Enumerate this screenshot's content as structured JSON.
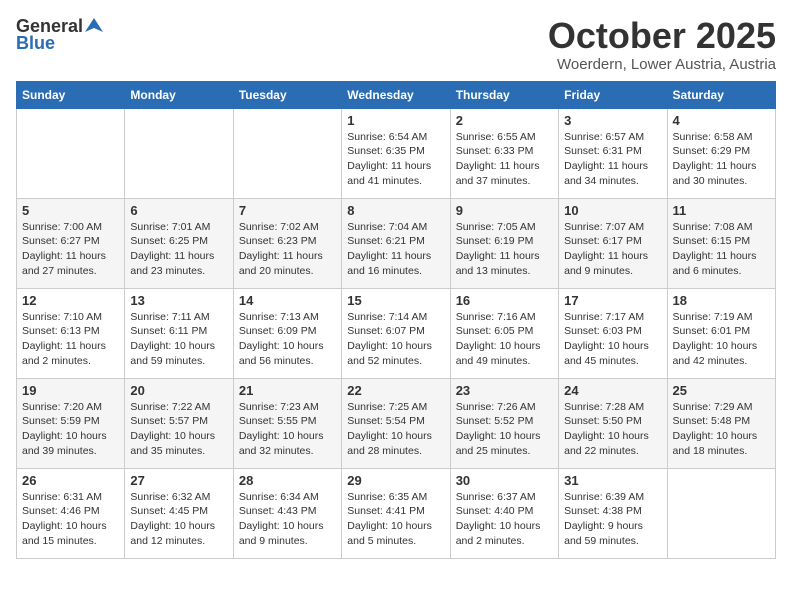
{
  "header": {
    "logo_general": "General",
    "logo_blue": "Blue",
    "month_title": "October 2025",
    "location": "Woerdern, Lower Austria, Austria"
  },
  "weekdays": [
    "Sunday",
    "Monday",
    "Tuesday",
    "Wednesday",
    "Thursday",
    "Friday",
    "Saturday"
  ],
  "weeks": [
    [
      {
        "day": "",
        "info": ""
      },
      {
        "day": "",
        "info": ""
      },
      {
        "day": "",
        "info": ""
      },
      {
        "day": "1",
        "info": "Sunrise: 6:54 AM\nSunset: 6:35 PM\nDaylight: 11 hours\nand 41 minutes."
      },
      {
        "day": "2",
        "info": "Sunrise: 6:55 AM\nSunset: 6:33 PM\nDaylight: 11 hours\nand 37 minutes."
      },
      {
        "day": "3",
        "info": "Sunrise: 6:57 AM\nSunset: 6:31 PM\nDaylight: 11 hours\nand 34 minutes."
      },
      {
        "day": "4",
        "info": "Sunrise: 6:58 AM\nSunset: 6:29 PM\nDaylight: 11 hours\nand 30 minutes."
      }
    ],
    [
      {
        "day": "5",
        "info": "Sunrise: 7:00 AM\nSunset: 6:27 PM\nDaylight: 11 hours\nand 27 minutes."
      },
      {
        "day": "6",
        "info": "Sunrise: 7:01 AM\nSunset: 6:25 PM\nDaylight: 11 hours\nand 23 minutes."
      },
      {
        "day": "7",
        "info": "Sunrise: 7:02 AM\nSunset: 6:23 PM\nDaylight: 11 hours\nand 20 minutes."
      },
      {
        "day": "8",
        "info": "Sunrise: 7:04 AM\nSunset: 6:21 PM\nDaylight: 11 hours\nand 16 minutes."
      },
      {
        "day": "9",
        "info": "Sunrise: 7:05 AM\nSunset: 6:19 PM\nDaylight: 11 hours\nand 13 minutes."
      },
      {
        "day": "10",
        "info": "Sunrise: 7:07 AM\nSunset: 6:17 PM\nDaylight: 11 hours\nand 9 minutes."
      },
      {
        "day": "11",
        "info": "Sunrise: 7:08 AM\nSunset: 6:15 PM\nDaylight: 11 hours\nand 6 minutes."
      }
    ],
    [
      {
        "day": "12",
        "info": "Sunrise: 7:10 AM\nSunset: 6:13 PM\nDaylight: 11 hours\nand 2 minutes."
      },
      {
        "day": "13",
        "info": "Sunrise: 7:11 AM\nSunset: 6:11 PM\nDaylight: 10 hours\nand 59 minutes."
      },
      {
        "day": "14",
        "info": "Sunrise: 7:13 AM\nSunset: 6:09 PM\nDaylight: 10 hours\nand 56 minutes."
      },
      {
        "day": "15",
        "info": "Sunrise: 7:14 AM\nSunset: 6:07 PM\nDaylight: 10 hours\nand 52 minutes."
      },
      {
        "day": "16",
        "info": "Sunrise: 7:16 AM\nSunset: 6:05 PM\nDaylight: 10 hours\nand 49 minutes."
      },
      {
        "day": "17",
        "info": "Sunrise: 7:17 AM\nSunset: 6:03 PM\nDaylight: 10 hours\nand 45 minutes."
      },
      {
        "day": "18",
        "info": "Sunrise: 7:19 AM\nSunset: 6:01 PM\nDaylight: 10 hours\nand 42 minutes."
      }
    ],
    [
      {
        "day": "19",
        "info": "Sunrise: 7:20 AM\nSunset: 5:59 PM\nDaylight: 10 hours\nand 39 minutes."
      },
      {
        "day": "20",
        "info": "Sunrise: 7:22 AM\nSunset: 5:57 PM\nDaylight: 10 hours\nand 35 minutes."
      },
      {
        "day": "21",
        "info": "Sunrise: 7:23 AM\nSunset: 5:55 PM\nDaylight: 10 hours\nand 32 minutes."
      },
      {
        "day": "22",
        "info": "Sunrise: 7:25 AM\nSunset: 5:54 PM\nDaylight: 10 hours\nand 28 minutes."
      },
      {
        "day": "23",
        "info": "Sunrise: 7:26 AM\nSunset: 5:52 PM\nDaylight: 10 hours\nand 25 minutes."
      },
      {
        "day": "24",
        "info": "Sunrise: 7:28 AM\nSunset: 5:50 PM\nDaylight: 10 hours\nand 22 minutes."
      },
      {
        "day": "25",
        "info": "Sunrise: 7:29 AM\nSunset: 5:48 PM\nDaylight: 10 hours\nand 18 minutes."
      }
    ],
    [
      {
        "day": "26",
        "info": "Sunrise: 6:31 AM\nSunset: 4:46 PM\nDaylight: 10 hours\nand 15 minutes."
      },
      {
        "day": "27",
        "info": "Sunrise: 6:32 AM\nSunset: 4:45 PM\nDaylight: 10 hours\nand 12 minutes."
      },
      {
        "day": "28",
        "info": "Sunrise: 6:34 AM\nSunset: 4:43 PM\nDaylight: 10 hours\nand 9 minutes."
      },
      {
        "day": "29",
        "info": "Sunrise: 6:35 AM\nSunset: 4:41 PM\nDaylight: 10 hours\nand 5 minutes."
      },
      {
        "day": "30",
        "info": "Sunrise: 6:37 AM\nSunset: 4:40 PM\nDaylight: 10 hours\nand 2 minutes."
      },
      {
        "day": "31",
        "info": "Sunrise: 6:39 AM\nSunset: 4:38 PM\nDaylight: 9 hours\nand 59 minutes."
      },
      {
        "day": "",
        "info": ""
      }
    ]
  ]
}
